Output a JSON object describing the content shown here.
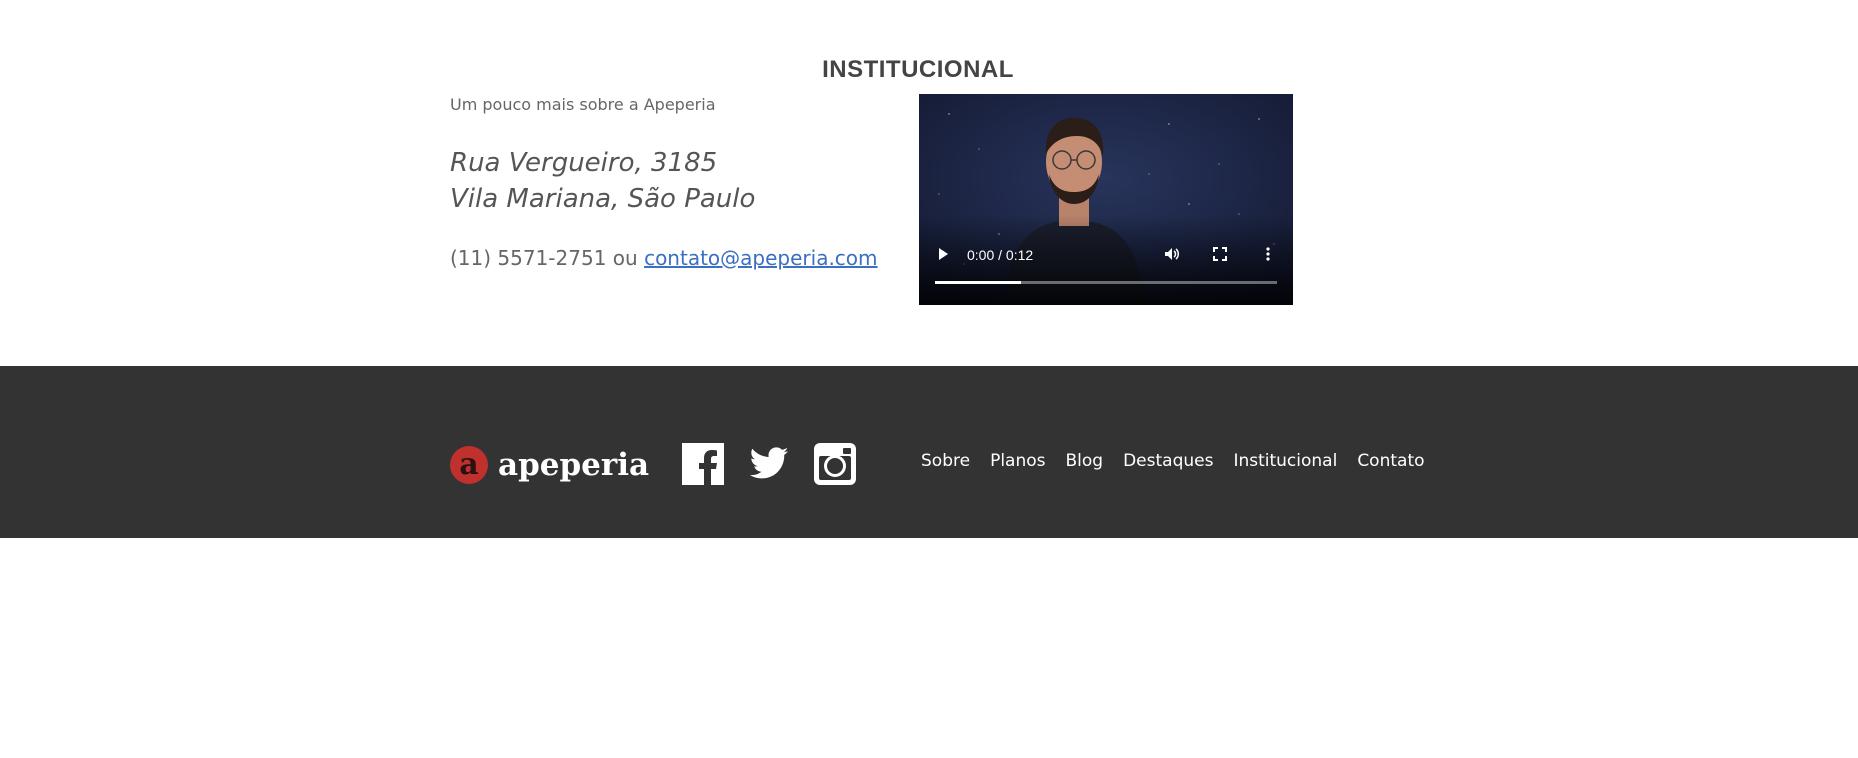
{
  "section": {
    "title": "INSTITUCIONAL",
    "subtitle": "Um pouco mais sobre a Apeperia"
  },
  "address": {
    "line1": "Rua Vergueiro, 3185",
    "line2": "Vila Mariana, São Paulo"
  },
  "contact": {
    "phone": "(11) 5571-2751",
    "separator": "ou",
    "email": "contato@apeperia.com"
  },
  "video": {
    "time": "0:00 / 0:12",
    "progress": 0.25,
    "icons": [
      "play-icon",
      "volume-icon",
      "fullscreen-icon",
      "more-options-icon"
    ]
  },
  "footer": {
    "logo_mark": "a",
    "logo_text": "apeperia",
    "social": [
      "facebook-icon",
      "twitter-icon",
      "instagram-icon"
    ],
    "nav": [
      "Sobre",
      "Planos",
      "Blog",
      "Destaques",
      "Institucional",
      "Contato"
    ]
  },
  "colors": {
    "footer_bg": "#333333",
    "link": "#3a6fc2",
    "logo_red": "#c0302c"
  }
}
